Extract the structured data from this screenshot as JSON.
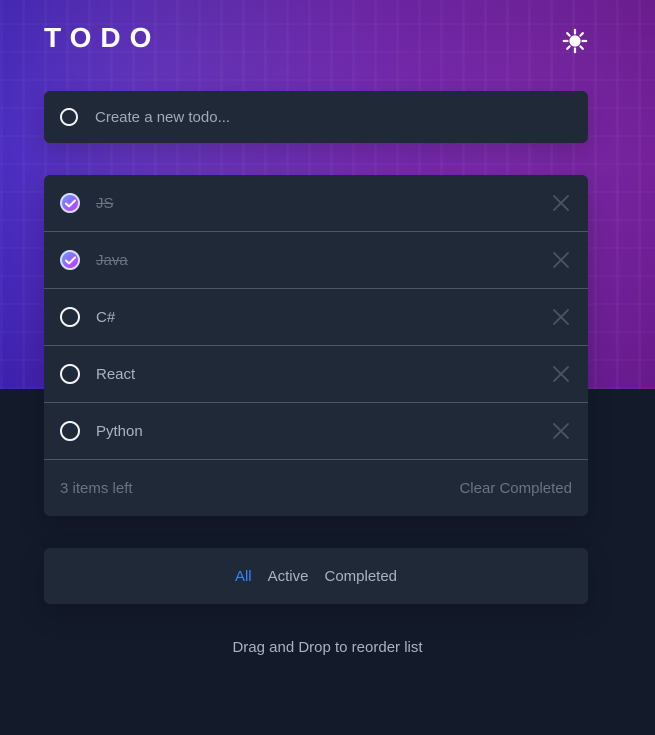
{
  "app": {
    "title": "TODO",
    "theme_icon": "sun-icon"
  },
  "create": {
    "placeholder": "Create a new todo..."
  },
  "todos": [
    {
      "label": "JS",
      "completed": true
    },
    {
      "label": "Java",
      "completed": true
    },
    {
      "label": "C#",
      "completed": false
    },
    {
      "label": "React",
      "completed": false
    },
    {
      "label": "Python",
      "completed": false
    }
  ],
  "footer": {
    "items_left": "3 items left",
    "clear_completed": "Clear Completed"
  },
  "filters": {
    "all": "All",
    "active": "Active",
    "completed": "Completed",
    "selected": "All"
  },
  "hint": "Drag and Drop to reorder list",
  "colors": {
    "accent": "#3b82f6",
    "card_bg": "#1f2937",
    "page_bg": "#131a2a"
  }
}
